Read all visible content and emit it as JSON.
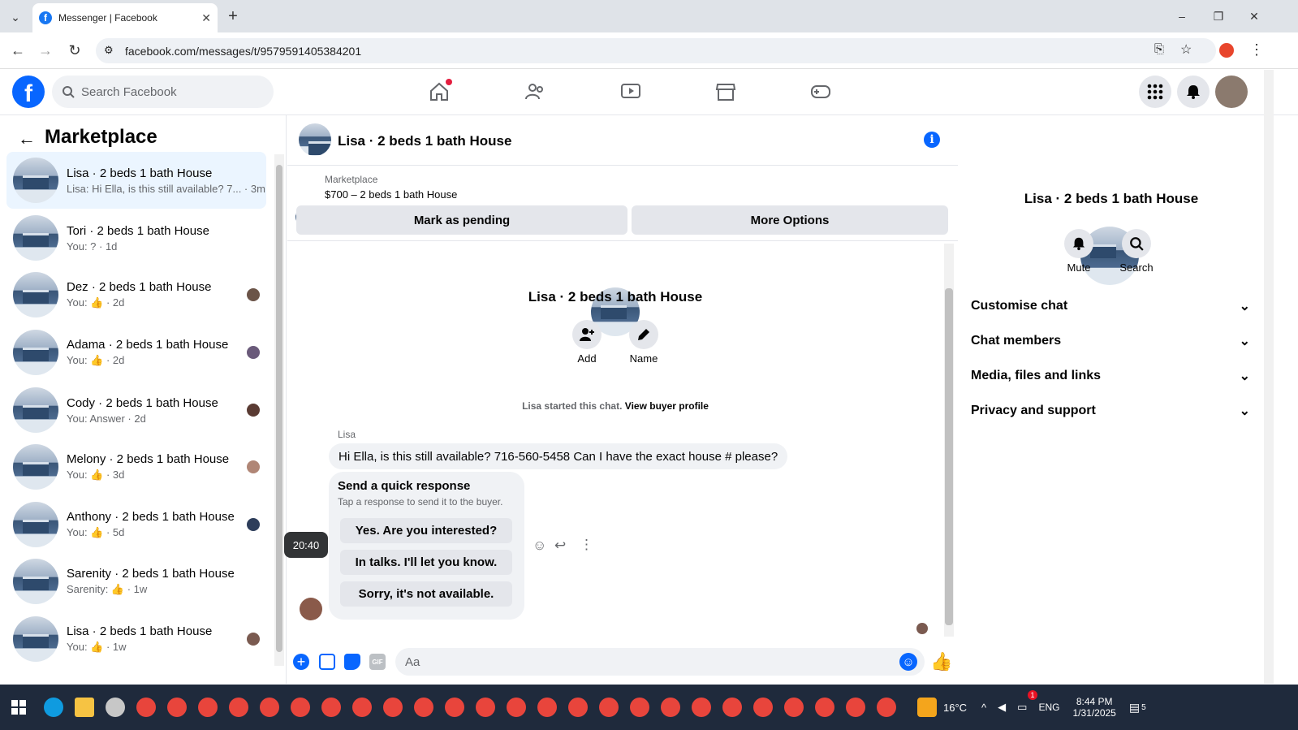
{
  "browser": {
    "tab_title": "Messenger | Facebook",
    "url": "facebook.com/messages/t/9579591405384201",
    "new_tab": "+",
    "close": "✕"
  },
  "fb": {
    "logo": "f",
    "search_placeholder": "Search Facebook"
  },
  "left": {
    "title": "Marketplace",
    "conversations": [
      {
        "name": "Lisa · 2 beds 1 bath House",
        "preview": "Lisa: Hi Ella, is this still available? 7... · 3m",
        "active": true
      },
      {
        "name": "Tori · 2 beds 1 bath House",
        "preview": "You: ? · 1d"
      },
      {
        "name": "Dez · 2 beds 1 bath House",
        "preview": "You: 👍 · 2d"
      },
      {
        "name": "Adama · 2 beds 1 bath House",
        "preview": "You: 👍 · 2d"
      },
      {
        "name": "Cody · 2 beds 1 bath House",
        "preview": "You: Answer · 2d"
      },
      {
        "name": "Melony · 2 beds 1 bath House",
        "preview": "You: 👍 · 3d"
      },
      {
        "name": "Anthony · 2 beds 1 bath House",
        "preview": "You: 👍 · 5d"
      },
      {
        "name": "Sarenity · 2 beds 1 bath House",
        "preview": "Sarenity: 👍 · 1w"
      },
      {
        "name": "Lisa · 2 beds 1 bath House",
        "preview": "You: 👍 · 1w"
      }
    ]
  },
  "chat": {
    "title": "Lisa · 2 beds 1 bath House",
    "mp_label": "Marketplace",
    "listing": "$700 – 2 beds 1 bath House",
    "pending_btn": "Mark as pending",
    "more_btn": "More Options",
    "profile_name": "Lisa · 2 beds 1 bath House",
    "add_label": "Add",
    "name_label": "Name",
    "started_text": "Lisa started this chat.",
    "view_profile": "View buyer profile",
    "sender": "Lisa",
    "message": "Hi Ella, is this still available?  716-560-5458  Can I have the exact house # please?",
    "quick_title": "Send a quick response",
    "quick_sub": "Tap a response to send it to the buyer.",
    "quick_options": [
      "Yes. Are you interested?",
      "In talks. I'll let you know.",
      "Sorry, it's not available."
    ],
    "time_tooltip": "20:40",
    "composer_placeholder": "Aa"
  },
  "right": {
    "name": "Lisa · 2 beds 1 bath House",
    "mute": "Mute",
    "search": "Search",
    "sections": [
      "Customise chat",
      "Chat members",
      "Media, files and links",
      "Privacy and support"
    ]
  },
  "taskbar": {
    "weather": "16°C",
    "lang": "ENG",
    "time": "8:44 PM",
    "date": "1/31/2025",
    "notif": "5",
    "weather_badge": "1"
  },
  "colors": {
    "brand": "#0866ff",
    "active_row": "#ebf5ff",
    "taskbar": "#1f2a3c"
  }
}
